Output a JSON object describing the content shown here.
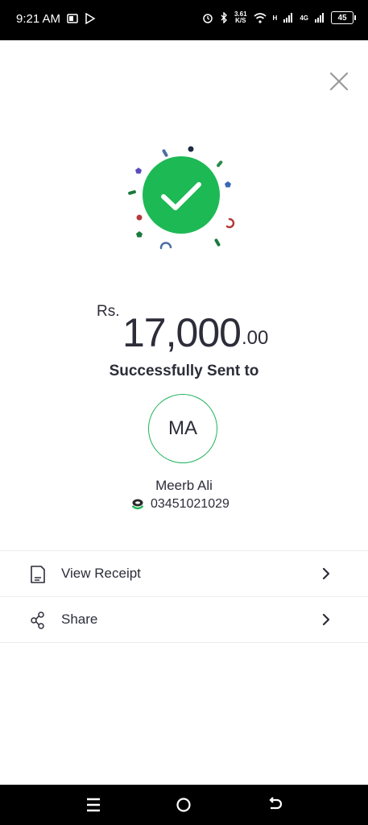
{
  "status_bar": {
    "time": "9:21 AM",
    "speed_value": "3.61",
    "speed_unit": "K/S",
    "network_h": "H",
    "network_4g": "4G",
    "battery": "45"
  },
  "icons": {
    "close": "close-icon",
    "success": "checkmark-circle-icon",
    "wallet": "wallet-logo-icon",
    "receipt": "receipt-icon",
    "share": "share-icon",
    "chevron": "chevron-right-icon"
  },
  "colors": {
    "accent_green": "#1db954",
    "text_dark": "#2d2d3a",
    "divider": "#ececec"
  },
  "amount": {
    "currency": "Rs.",
    "integer": "17,000",
    "decimal": ".00"
  },
  "status_message": "Successfully Sent to",
  "recipient": {
    "initials": "MA",
    "name": "Meerb Ali",
    "number": "03451021029"
  },
  "actions": [
    {
      "label": "View Receipt"
    },
    {
      "label": "Share"
    }
  ]
}
